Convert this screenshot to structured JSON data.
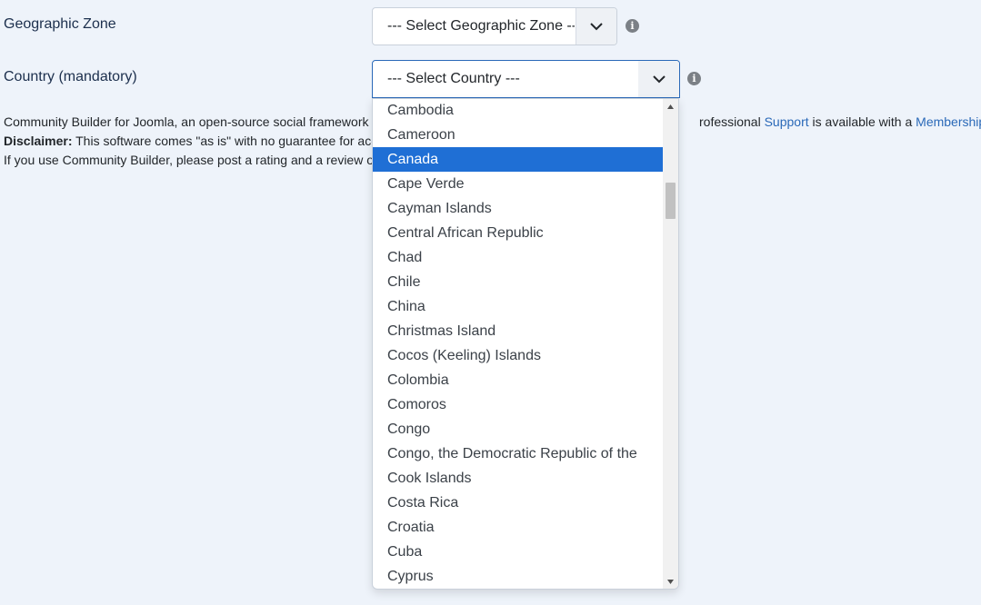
{
  "form": {
    "geo_zone": {
      "label": "Geographic Zone",
      "value": "--- Select Geographic Zone ---"
    },
    "country": {
      "label": "Country (mandatory)",
      "value": "--- Select Country ---"
    }
  },
  "footer": {
    "line1_prefix": "Community Builder for Joomla, an open-source social framework",
    "line1_suffix_a": "rofessional",
    "support_link": "Support",
    "line1_suffix_b": "is available with a",
    "membership_link": "Membership",
    "line1_end": ".",
    "disclaimer_label": "Disclaimer:",
    "disclaimer_text": "This software comes \"as is\" with no guarantee for acc",
    "line3": "If you use Community Builder, please post a rating and a review on"
  },
  "dropdown": {
    "options": [
      "Cambodia",
      "Cameroon",
      "Canada",
      "Cape Verde",
      "Cayman Islands",
      "Central African Republic",
      "Chad",
      "Chile",
      "China",
      "Christmas Island",
      "Cocos (Keeling) Islands",
      "Colombia",
      "Comoros",
      "Congo",
      "Congo, the Democratic Republic of the",
      "Cook Islands",
      "Costa Rica",
      "Croatia",
      "Cuba",
      "Cyprus"
    ],
    "selected_index": 2
  },
  "icons": {
    "caret": "chevron-down-icon",
    "info": "info-icon",
    "info_glyph": "i"
  },
  "colors": {
    "page_bg": "#eef3fa",
    "selected_bg": "#1f6fd5",
    "link": "#2a69b8",
    "label": "#1c2f4d"
  }
}
